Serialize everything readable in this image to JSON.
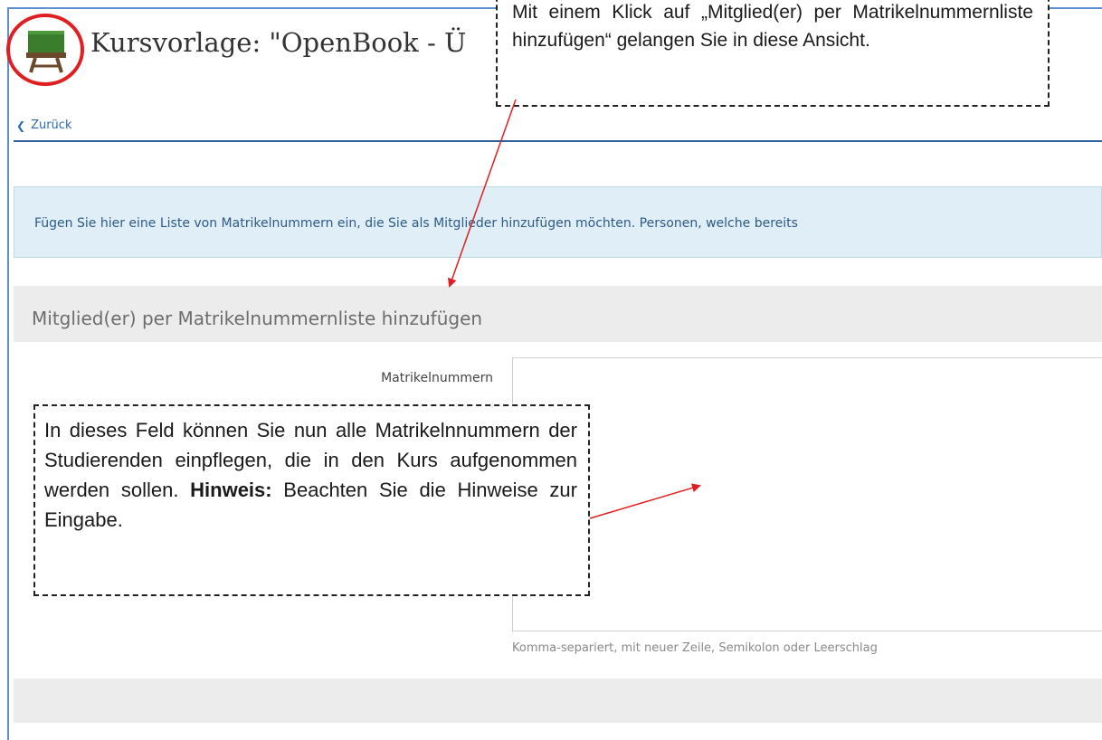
{
  "header": {
    "title": "Kursvorlage: \"OpenBook - Ü"
  },
  "nav": {
    "back_label": "Zurück"
  },
  "info": {
    "text": "Fügen Sie hier eine Liste von Matrikelnummern ein, die Sie als Mitglieder hinzufügen möchten. Personen, welche bereits"
  },
  "form": {
    "section_title": "Mitglied(er) per Matrikelnummernliste hinzufügen",
    "field_label": "Matrikelnummern",
    "field_value": "",
    "field_hint": "Komma-separiert, mit neuer Zeile, Semikolon oder Leerschlag"
  },
  "annotations": {
    "top_callout": "Mit einem Klick auf „Mitglied(er) per Matrikelnummernliste hinzufügen“ gelangen Sie in diese Ansicht.",
    "bottom_callout_text": "In dieses Feld können Sie nun alle Matrikelnnummern der Studierenden einpflegen, die in den Kurs aufgenommen werden sollen. ",
    "bottom_callout_bold": "Hinweis:",
    "bottom_callout_tail": " Beachten Sie die Hinweise zur Eingabe.",
    "circle_color": "#e02020",
    "arrow_color": "#e02020"
  },
  "icons": {
    "course_icon": "blackboard-icon"
  },
  "colors": {
    "link": "#2a6aa8",
    "info_bg": "#dfeef7",
    "nav_rule": "#2e5d9a",
    "section_bg": "#ececec"
  }
}
